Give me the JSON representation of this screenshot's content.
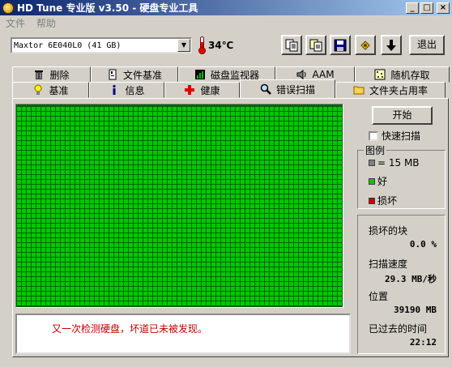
{
  "window": {
    "title": "HD Tune 专业版 v3.50 - 硬盘专业工具",
    "minimize": "_",
    "maximize": "□",
    "close": "×"
  },
  "menu": {
    "items": [
      "文件",
      "帮助"
    ]
  },
  "toolbar": {
    "drive": "Maxtor 6E040L0 (41 GB)",
    "temperature": "34℃",
    "buttons": [
      "copy-text-icon",
      "copy-screen-icon",
      "save-icon",
      "options-icon",
      "down-arrow-icon"
    ],
    "exit_label": "退出"
  },
  "tabs": {
    "row1": [
      {
        "label": "删除",
        "icon": "trash-icon"
      },
      {
        "label": "文件基准",
        "icon": "file-benchmark-icon"
      },
      {
        "label": "磁盘监视器",
        "icon": "disk-monitor-icon"
      },
      {
        "label": "AAM",
        "icon": "speaker-icon"
      },
      {
        "label": "随机存取",
        "icon": "random-access-icon"
      }
    ],
    "row2": [
      {
        "label": "基准",
        "icon": "lightbulb-icon"
      },
      {
        "label": "信息",
        "icon": "info-icon"
      },
      {
        "label": "健康",
        "icon": "health-cross-icon"
      },
      {
        "label": "错误扫描",
        "icon": "magnifier-icon",
        "active": true
      },
      {
        "label": "文件夹占用率",
        "icon": "folder-icon"
      }
    ]
  },
  "scan": {
    "start_label": "开始",
    "quick_scan_label": "快速扫描",
    "quick_scan_checked": false,
    "log_message": "又一次检测硬盘，坏道已未被发现。"
  },
  "legend": {
    "title": "图例",
    "block_size": "= 15 MB",
    "good": "好",
    "damaged": "损坏"
  },
  "stats": {
    "damaged_blocks_label": "损坏的块",
    "damaged_blocks_value": "0.0 %",
    "scan_speed_label": "扫描速度",
    "scan_speed_value": "29.3 MB/秒",
    "position_label": "位置",
    "position_value": "39190 MB",
    "elapsed_label": "已过去的时间",
    "elapsed_value": "22:12"
  },
  "colors": {
    "good": "#00c800",
    "damaged": "#c80000",
    "neutral": "#808080",
    "grid_line": "#006400",
    "message": "#c00000"
  },
  "chart_data": {
    "type": "heatmap",
    "scanned_fraction": 1.0,
    "damaged_blocks": 0
  }
}
